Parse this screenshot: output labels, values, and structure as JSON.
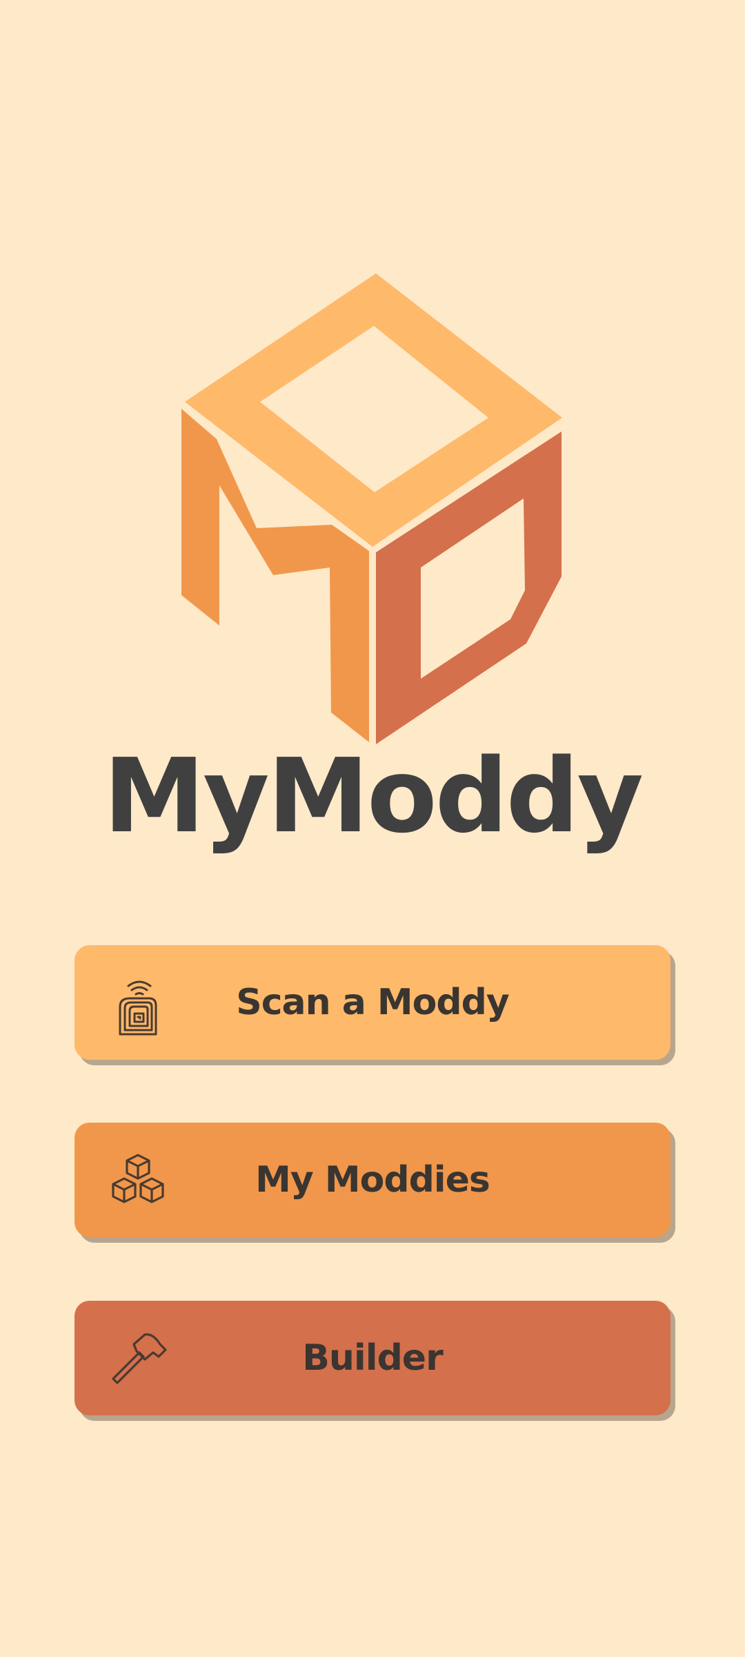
{
  "app": {
    "title": "MyModdy"
  },
  "logo": {
    "icon": "cube-logo-icon",
    "colors": {
      "top": "#FFB96B",
      "left": "#F1974B",
      "right": "#D4704C"
    }
  },
  "menu": {
    "items": [
      {
        "label": "Scan a Moddy",
        "icon": "nfc-tag-icon",
        "color": "#FFB96B"
      },
      {
        "label": "My Moddies",
        "icon": "cubes-icon",
        "color": "#F1974B"
      },
      {
        "label": "Builder",
        "icon": "hammer-icon",
        "color": "#D4704C"
      }
    ]
  },
  "theme": {
    "background": "#FEE9C9",
    "text": "#404040",
    "shadow": "#B8A58E"
  }
}
